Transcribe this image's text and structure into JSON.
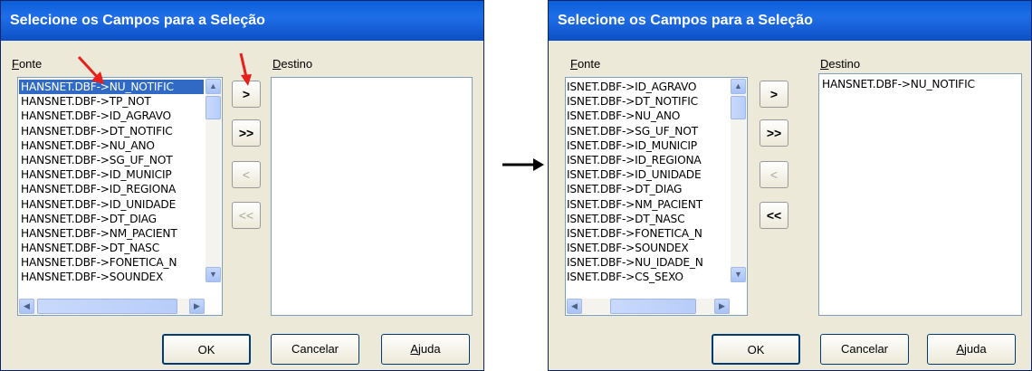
{
  "left": {
    "title": "Selecione os Campos para a Seleção",
    "fonte_label": "Fonte",
    "destino_label": "Destino",
    "fonte_items": [
      "HANSNET.DBF->NU_NOTIFIC",
      "HANSNET.DBF->TP_NOT",
      "HANSNET.DBF->ID_AGRAVO",
      "HANSNET.DBF->DT_NOTIFIC",
      "HANSNET.DBF->NU_ANO",
      "HANSNET.DBF->SG_UF_NOT",
      "HANSNET.DBF->ID_MUNICIP",
      "HANSNET.DBF->ID_REGIONA",
      "HANSNET.DBF->ID_UNIDADE",
      "HANSNET.DBF->DT_DIAG",
      "HANSNET.DBF->NM_PACIENT",
      "HANSNET.DBF->DT_NASC",
      "HANSNET.DBF->FONETICA_N",
      "HANSNET.DBF->SOUNDEX"
    ],
    "selected_index": 0,
    "destino_items": [],
    "buttons": {
      "add_one": ">",
      "add_all": ">>",
      "remove_one": "<",
      "remove_all": "<<"
    },
    "ok": "OK",
    "cancel": "Cancelar",
    "help": "Ajuda"
  },
  "right": {
    "title": "Selecione os Campos para a Seleção",
    "fonte_label": "Fonte",
    "destino_label": "Destino",
    "fonte_items": [
      "ISNET.DBF->ID_AGRAVO",
      "ISNET.DBF->DT_NOTIFIC",
      "ISNET.DBF->NU_ANO",
      "ISNET.DBF->SG_UF_NOT",
      "ISNET.DBF->ID_MUNICIP",
      "ISNET.DBF->ID_REGIONA",
      "ISNET.DBF->ID_UNIDADE",
      "ISNET.DBF->DT_DIAG",
      "ISNET.DBF->NM_PACIENT",
      "ISNET.DBF->DT_NASC",
      "ISNET.DBF->FONETICA_N",
      "ISNET.DBF->SOUNDEX",
      "ISNET.DBF->NU_IDADE_N",
      "ISNET.DBF->CS_SEXO"
    ],
    "destino_items": [
      "HANSNET.DBF->NU_NOTIFIC"
    ],
    "buttons": {
      "add_one": ">",
      "add_all": ">>",
      "remove_one": "<",
      "remove_all": "<<"
    },
    "ok": "OK",
    "cancel": "Cancelar",
    "help": "Ajuda"
  },
  "colors": {
    "titlebar": "#0a5fd8",
    "selection": "#316ac5",
    "red_arrow": "#e8201b",
    "dialog_bg": "#ece9d8"
  },
  "icons": {
    "arrow_indicator": "red-arrow-icon",
    "transition": "black-arrow-icon"
  }
}
